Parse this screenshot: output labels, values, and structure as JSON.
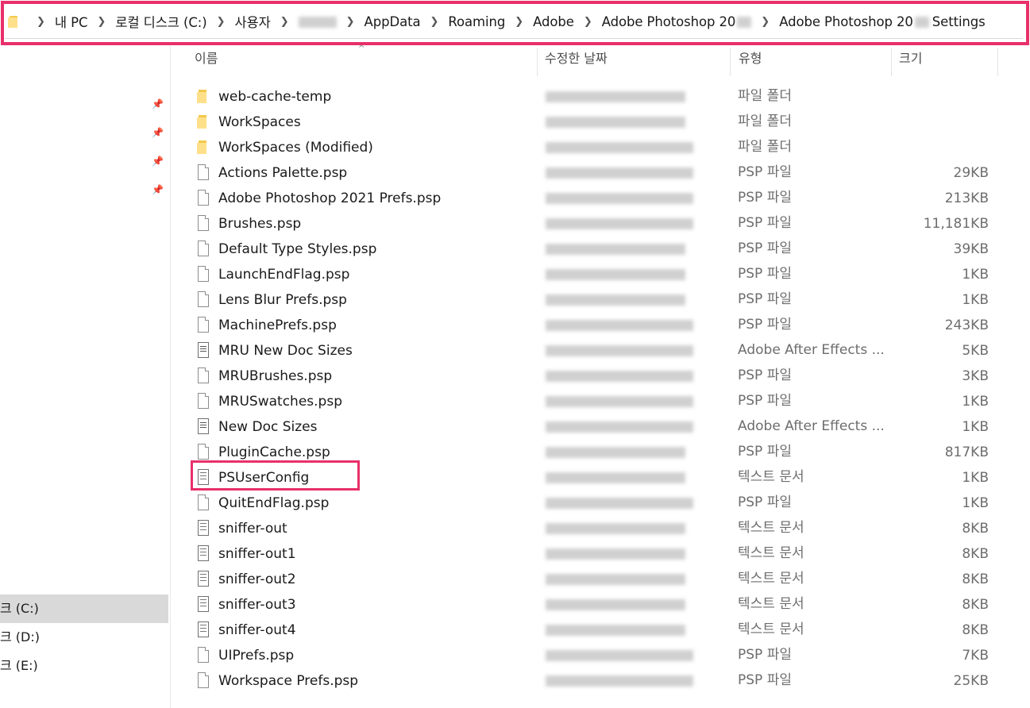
{
  "address_bar": {
    "crumbs": [
      "내 PC",
      "로컬 디스크 (C:)",
      "사용자",
      "",
      "AppData",
      "Roaming",
      "Adobe",
      "Adobe Photoshop 20",
      "Adobe Photoshop 20",
      "Settings"
    ]
  },
  "navigation": {
    "drives": [
      "크 (C:)",
      "크 (D:)",
      "크 (E:)"
    ],
    "selected_drive": "크 (C:)"
  },
  "columns": {
    "name": "이름",
    "date": "수정한 날짜",
    "type": "유형",
    "size": "크기"
  },
  "files": [
    {
      "name": "web-cache-temp",
      "type": "파일 폴더",
      "size": "",
      "icon": "folder-icon"
    },
    {
      "name": "WorkSpaces",
      "type": "파일 폴더",
      "size": "",
      "icon": "folder-icon"
    },
    {
      "name": "WorkSpaces (Modified)",
      "type": "파일 폴더",
      "size": "",
      "icon": "folder-icon"
    },
    {
      "name": "Actions Palette.psp",
      "type": "PSP 파일",
      "size": "29KB",
      "icon": "file-icon"
    },
    {
      "name": "Adobe Photoshop 2021 Prefs.psp",
      "type": "PSP 파일",
      "size": "213KB",
      "icon": "file-icon"
    },
    {
      "name": "Brushes.psp",
      "type": "PSP 파일",
      "size": "11,181KB",
      "icon": "file-icon"
    },
    {
      "name": "Default Type Styles.psp",
      "type": "PSP 파일",
      "size": "39KB",
      "icon": "file-icon"
    },
    {
      "name": "LaunchEndFlag.psp",
      "type": "PSP 파일",
      "size": "1KB",
      "icon": "file-icon"
    },
    {
      "name": "Lens Blur Prefs.psp",
      "type": "PSP 파일",
      "size": "1KB",
      "icon": "file-icon"
    },
    {
      "name": "MachinePrefs.psp",
      "type": "PSP 파일",
      "size": "243KB",
      "icon": "file-icon"
    },
    {
      "name": "MRU New Doc Sizes",
      "type": "Adobe After Effects ...",
      "size": "5KB",
      "icon": "list-file-icon"
    },
    {
      "name": "MRUBrushes.psp",
      "type": "PSP 파일",
      "size": "3KB",
      "icon": "file-icon"
    },
    {
      "name": "MRUSwatches.psp",
      "type": "PSP 파일",
      "size": "1KB",
      "icon": "file-icon"
    },
    {
      "name": "New Doc Sizes",
      "type": "Adobe After Effects ...",
      "size": "1KB",
      "icon": "list-file-icon"
    },
    {
      "name": "PluginCache.psp",
      "type": "PSP 파일",
      "size": "817KB",
      "icon": "file-icon"
    },
    {
      "name": "PSUserConfig",
      "type": "텍스트 문서",
      "size": "1KB",
      "icon": "text-file-icon"
    },
    {
      "name": "QuitEndFlag.psp",
      "type": "PSP 파일",
      "size": "1KB",
      "icon": "file-icon"
    },
    {
      "name": "sniffer-out",
      "type": "텍스트 문서",
      "size": "8KB",
      "icon": "text-file-icon"
    },
    {
      "name": "sniffer-out1",
      "type": "텍스트 문서",
      "size": "8KB",
      "icon": "text-file-icon"
    },
    {
      "name": "sniffer-out2",
      "type": "텍스트 문서",
      "size": "8KB",
      "icon": "text-file-icon"
    },
    {
      "name": "sniffer-out3",
      "type": "텍스트 문서",
      "size": "8KB",
      "icon": "text-file-icon"
    },
    {
      "name": "sniffer-out4",
      "type": "텍스트 문서",
      "size": "8KB",
      "icon": "text-file-icon"
    },
    {
      "name": "UIPrefs.psp",
      "type": "PSP 파일",
      "size": "7KB",
      "icon": "file-icon"
    },
    {
      "name": "Workspace Prefs.psp",
      "type": "PSP 파일",
      "size": "25KB",
      "icon": "file-icon"
    }
  ],
  "highlight": {
    "address_bar": true,
    "file": "PSUserConfig"
  },
  "colors": {
    "highlight": "#e8306a",
    "selected_nav": "#d9d9d9",
    "folder": "#f2c94c"
  }
}
